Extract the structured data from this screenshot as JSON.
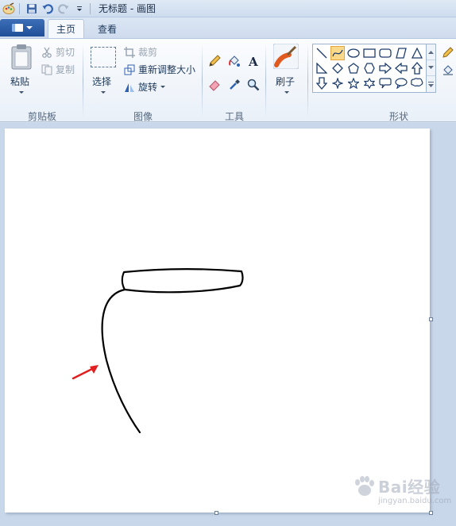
{
  "window": {
    "title": "无标题 - 画图"
  },
  "tabs": {
    "home": "主页",
    "view": "查看"
  },
  "clipboard": {
    "paste": "粘贴",
    "cut": "剪切",
    "copy": "复制",
    "group_label": "剪贴板"
  },
  "image": {
    "select": "选择",
    "crop": "裁剪",
    "resize": "重新调整大小",
    "rotate": "旋转",
    "group_label": "图像"
  },
  "tools": {
    "group_label": "工具",
    "items": [
      "pencil-icon",
      "fill-icon",
      "text-icon",
      "eraser-icon",
      "color-picker-icon",
      "magnifier-icon"
    ]
  },
  "brushes": {
    "label": "刷子"
  },
  "shapes": {
    "group_label": "形状",
    "selected": "curve",
    "items": [
      "line",
      "curve",
      "oval",
      "rectangle",
      "rounded-rectangle",
      "polygon",
      "triangle",
      "right-triangle",
      "diamond",
      "pentagon",
      "hexagon",
      "right-arrow",
      "left-arrow",
      "up-arrow",
      "down-arrow",
      "four-point-star",
      "five-point-star",
      "six-point-star",
      "rounded-callout",
      "oval-callout",
      "cloud-callout"
    ]
  },
  "watermark": {
    "text": "Bai经验",
    "sub": "jingyan.baidu.com"
  },
  "colors": {
    "accent": "#1f4f98",
    "selection": "#fbd98a",
    "arrow": "#e02020"
  }
}
